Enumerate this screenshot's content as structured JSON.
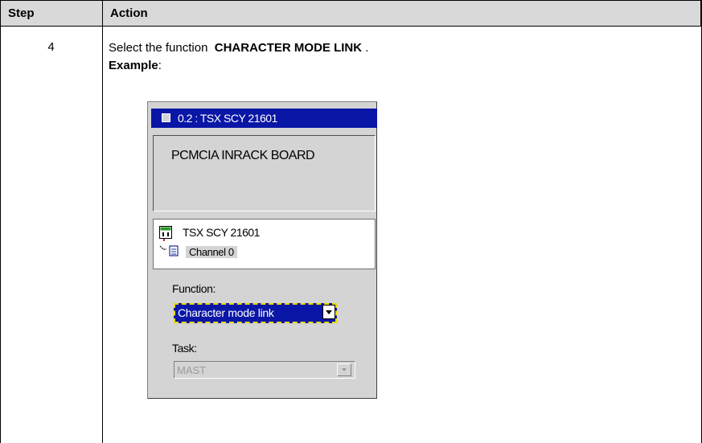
{
  "table": {
    "header": {
      "step": "Step",
      "action": "Action"
    },
    "row": {
      "step": "4",
      "line1_prefix": "Select the function",
      "line1_bold": "CHARACTER MODE LINK",
      "line1_suffix": ".",
      "line2_bold": "Example",
      "line2_suffix": ":"
    }
  },
  "screenshot": {
    "title": "0.2 : TSX SCY 21601",
    "board_label": "PCMCIA INRACK BOARD",
    "module_name": "TSX SCY 21601",
    "channel_label": "Channel 0",
    "function_label": "Function:",
    "function_value": "Character mode link",
    "task_label": "Task:",
    "task_value": "MAST"
  },
  "icons": {
    "title_box": "window-box-icon",
    "module": "module-icon",
    "channel": "channel-icon",
    "dropdown": "dropdown-arrow-icon"
  },
  "colors": {
    "header_bg": "#d9d9d9",
    "titlebar": "#0a16a6",
    "dialog_bg": "#d4d4d4",
    "focus_outline": "#e8d800"
  }
}
